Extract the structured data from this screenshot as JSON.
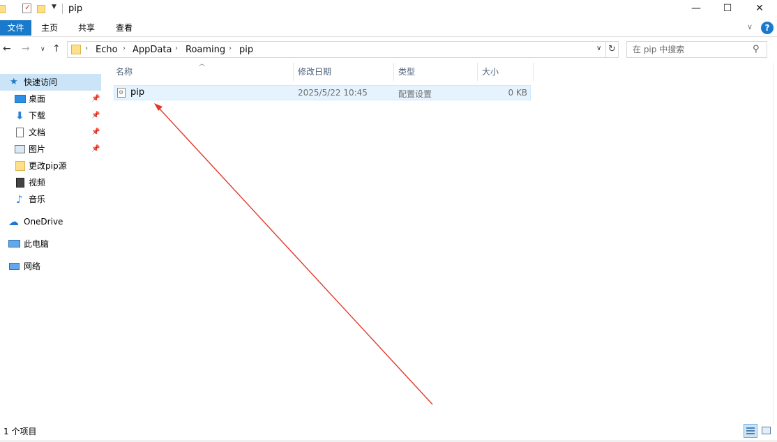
{
  "window": {
    "title": "pip",
    "minimize": "—",
    "maximize": "☐",
    "close": "✕"
  },
  "ribbon": {
    "file": "文件",
    "home": "主页",
    "share": "共享",
    "view": "查看",
    "help": "?"
  },
  "address": {
    "crumbs": [
      "Echo",
      "AppData",
      "Roaming",
      "pip"
    ],
    "search_placeholder": "在 pip 中搜索"
  },
  "nav": {
    "quick_access": "快速访问",
    "items": [
      {
        "label": "桌面",
        "pinned": true
      },
      {
        "label": "下载",
        "pinned": true
      },
      {
        "label": "文档",
        "pinned": true
      },
      {
        "label": "图片",
        "pinned": true
      },
      {
        "label": "更改pip源",
        "pinned": false
      },
      {
        "label": "视频",
        "pinned": false
      },
      {
        "label": "音乐",
        "pinned": false
      }
    ],
    "onedrive": "OneDrive",
    "this_pc": "此电脑",
    "network": "网络"
  },
  "columns": {
    "name": "名称",
    "modified": "修改日期",
    "type": "类型",
    "size": "大小"
  },
  "files": [
    {
      "name": "pip",
      "modified": "2025/5/22 10:45",
      "type": "配置设置",
      "size": "0 KB"
    }
  ],
  "status": {
    "count": "1 个项目"
  },
  "colors": {
    "accent": "#1979ca",
    "selection": "#cce4f7",
    "annotation_arrow": "#e0392b"
  }
}
